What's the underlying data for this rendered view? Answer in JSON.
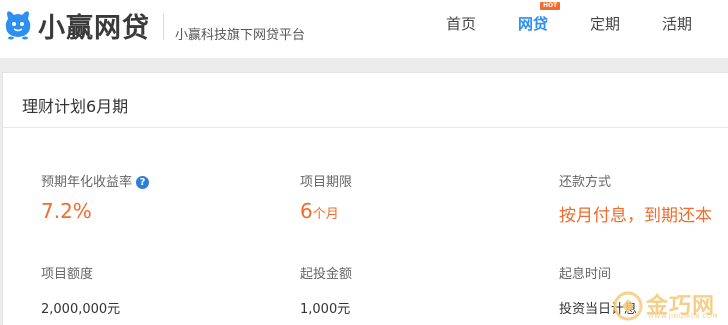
{
  "header": {
    "brand_name": "小赢网贷",
    "slogan": "小赢科技旗下网贷平台",
    "nav": [
      {
        "label": "首页",
        "active": false
      },
      {
        "label": "网贷",
        "active": true,
        "badge": "HOT"
      },
      {
        "label": "定期",
        "active": false
      },
      {
        "label": "活期",
        "active": false
      }
    ]
  },
  "plan": {
    "title": "理财计划6月期",
    "expected_rate_label": "预期年化收益率",
    "expected_rate": "7.2%",
    "term_label": "项目期限",
    "term_value": "6",
    "term_unit": "个月",
    "repay_label": "还款方式",
    "repay_value": "按月付息，到期还本",
    "amount_label": "项目额度",
    "amount_value": "2,000,000元",
    "min_invest_label": "起投金额",
    "min_invest_value": "1,000元",
    "interest_start_label": "起息时间",
    "interest_start_value": "投资当日计息"
  },
  "watermark": {
    "text": "金巧网",
    "sub": "WWW.JINQIAO8.COM"
  },
  "colors": {
    "accent": "#f26b2a",
    "nav_active": "#2d8ff0",
    "help_icon": "#2d7fd6"
  }
}
